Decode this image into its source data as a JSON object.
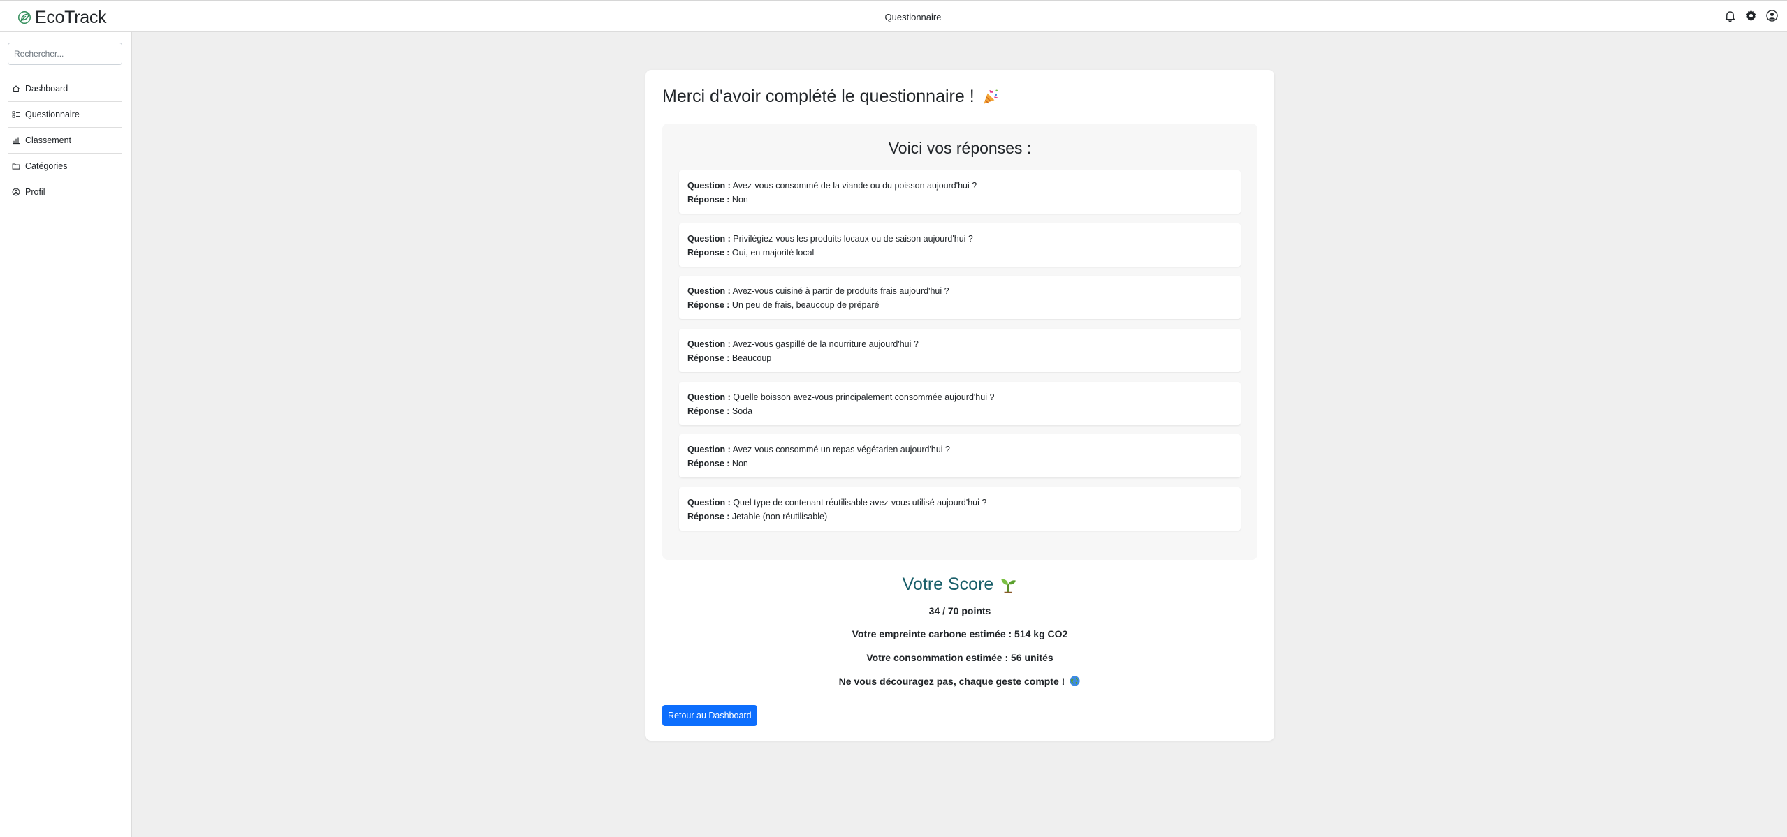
{
  "app": {
    "name": "EcoTrack"
  },
  "header": {
    "title": "Questionnaire"
  },
  "sidebar": {
    "search_placeholder": "Rechercher...",
    "items": [
      {
        "label": "Dashboard",
        "icon": "home-icon"
      },
      {
        "label": "Questionnaire",
        "icon": "list-icon"
      },
      {
        "label": "Classement",
        "icon": "bar-chart-icon"
      },
      {
        "label": "Catégories",
        "icon": "folder-icon"
      },
      {
        "label": "Profil",
        "icon": "user-circle-icon"
      }
    ]
  },
  "main": {
    "title": "Merci d'avoir complété le questionnaire !",
    "answers_title": "Voici vos réponses :",
    "question_label": "Question :",
    "answer_label": "Réponse :",
    "answers": [
      {
        "question": "Avez-vous consommé de la viande ou du poisson aujourd'hui ?",
        "answer": "Non"
      },
      {
        "question": "Privilégiez-vous les produits locaux ou de saison aujourd'hui ?",
        "answer": "Oui, en majorité local"
      },
      {
        "question": "Avez-vous cuisiné à partir de produits frais aujourd'hui ?",
        "answer": "Un peu de frais, beaucoup de préparé"
      },
      {
        "question": "Avez-vous gaspillé de la nourriture aujourd'hui ?",
        "answer": "Beaucoup"
      },
      {
        "question": "Quelle boisson avez-vous principalement consommée aujourd'hui ?",
        "answer": "Soda"
      },
      {
        "question": "Avez-vous consommé un repas végétarien aujourd'hui ?",
        "answer": "Non"
      },
      {
        "question": "Quel type de contenant réutilisable avez-vous utilisé aujourd'hui ?",
        "answer": "Jetable (non réutilisable)"
      }
    ],
    "score": {
      "title": "Votre Score",
      "points": "34 / 70 points",
      "carbon": "Votre empreinte carbone estimée : 514 kg CO2",
      "consumption": "Votre consommation estimée : 56 unités",
      "message": "Ne vous découragez pas, chaque geste compte !"
    },
    "back_button": "Retour au Dashboard"
  },
  "colors": {
    "primary": "#0d6efd",
    "score_title": "#1a5f6a",
    "brand_leaf": "#2e8b57"
  }
}
